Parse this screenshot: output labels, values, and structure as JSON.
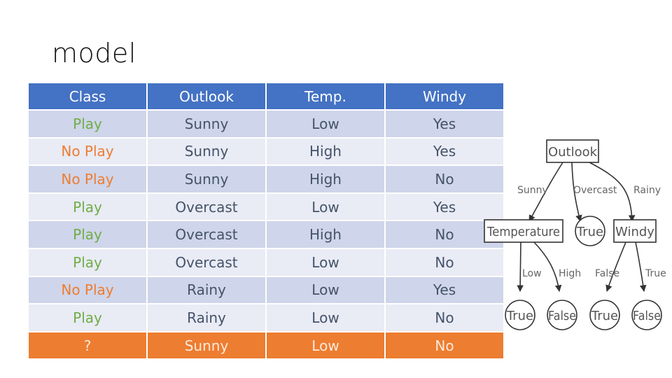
{
  "title": "model",
  "table": {
    "headers": [
      "Class",
      "Outlook",
      "Temp.",
      "Windy"
    ],
    "rows": [
      [
        "Play",
        "Sunny",
        "Low",
        "Yes"
      ],
      [
        "No Play",
        "Sunny",
        "High",
        "Yes"
      ],
      [
        "No Play",
        "Sunny",
        "High",
        "No"
      ],
      [
        "Play",
        "Overcast",
        "Low",
        "Yes"
      ],
      [
        "Play",
        "Overcast",
        "High",
        "No"
      ],
      [
        "Play",
        "Overcast",
        "Low",
        "No"
      ],
      [
        "No Play",
        "Rainy",
        "Low",
        "Yes"
      ],
      [
        "Play",
        "Rainy",
        "Low",
        "No"
      ]
    ],
    "query_row": [
      "?",
      "Sunny",
      "Low",
      "No"
    ]
  },
  "colors": {
    "header": "#4472c4",
    "row_odd": "#cfd5ea",
    "row_even": "#e9ebf5",
    "query": "#ed7d31",
    "play": "#70ad47",
    "no_play": "#ed7d31"
  },
  "tree": {
    "root": "Outlook",
    "edges_root": [
      "Sunny",
      "Overcast",
      "Rainy"
    ],
    "level1": [
      "Temperature",
      "True",
      "Windy"
    ],
    "edges_temp": [
      "Low",
      "High"
    ],
    "edges_windy": [
      "False",
      "True"
    ],
    "leaves": [
      "True",
      "False",
      "True",
      "False"
    ]
  }
}
